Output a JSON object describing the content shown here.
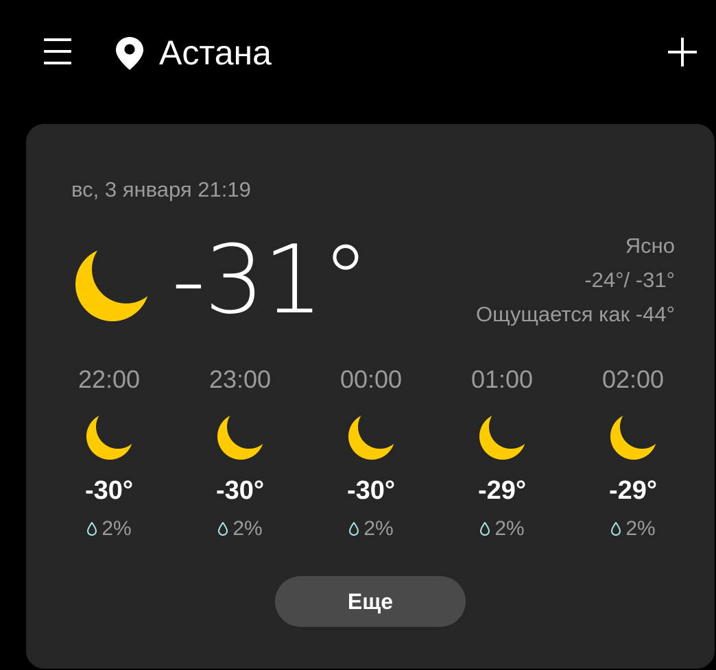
{
  "header": {
    "menu_icon": "hamburger-menu-icon",
    "location_icon": "location-pin-icon",
    "city": "Астана",
    "add_icon": "plus-icon"
  },
  "current": {
    "datetime": "вс, 3 января 21:19",
    "icon": "crescent-moon-icon",
    "temperature": "-31°",
    "condition": "Ясно",
    "high_low": "-24°/ -31°",
    "feels_like": "Ощущается как -44°"
  },
  "hourly": [
    {
      "time": "22:00",
      "icon": "crescent-moon-icon",
      "temp": "-30°",
      "precip": "2%"
    },
    {
      "time": "23:00",
      "icon": "crescent-moon-icon",
      "temp": "-30°",
      "precip": "2%"
    },
    {
      "time": "00:00",
      "icon": "crescent-moon-icon",
      "temp": "-30°",
      "precip": "2%"
    },
    {
      "time": "01:00",
      "icon": "crescent-moon-icon",
      "temp": "-29°",
      "precip": "2%"
    },
    {
      "time": "02:00",
      "icon": "crescent-moon-icon",
      "temp": "-29°",
      "precip": "2%"
    }
  ],
  "more_button": "Еще",
  "colors": {
    "background": "#000000",
    "card": "#262626",
    "moon": "#FFCC00",
    "secondary_text": "#9B9B9B",
    "button": "#4A4A4A",
    "drop": "#A8E6E6"
  }
}
